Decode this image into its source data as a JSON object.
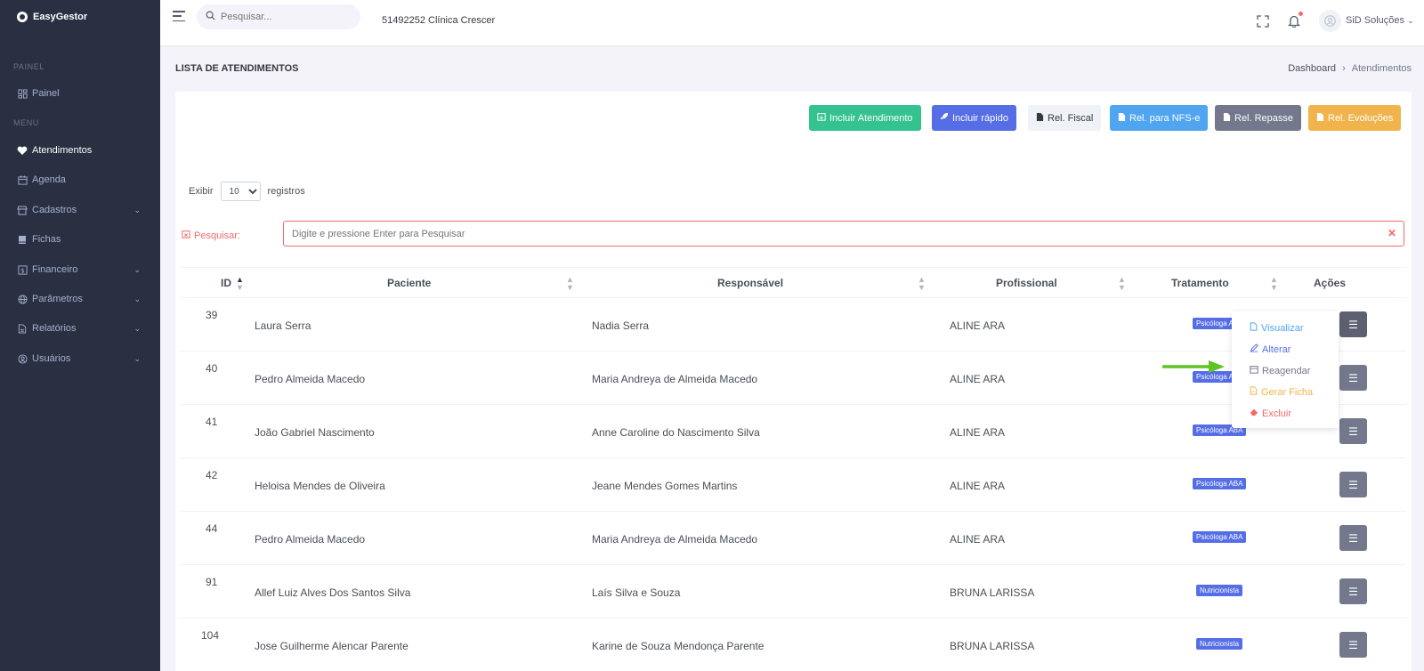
{
  "brand": {
    "name": "EasyGestor"
  },
  "sidebar": {
    "section_painel": "PAINEL",
    "section_menu": "MENU",
    "items": [
      {
        "label": "Painel",
        "icon": "dashboard-icon"
      },
      {
        "label": "Atendimentos",
        "icon": "heart-icon"
      },
      {
        "label": "Agenda",
        "icon": "calendar-icon"
      },
      {
        "label": "Cadastros",
        "icon": "store-icon"
      },
      {
        "label": "Fichas",
        "icon": "book-icon"
      },
      {
        "label": "Financeiro",
        "icon": "dollar-icon"
      },
      {
        "label": "Parâmetros",
        "icon": "globe-icon"
      },
      {
        "label": "Relatórios",
        "icon": "report-icon"
      },
      {
        "label": "Usuários",
        "icon": "user-circle-icon"
      }
    ]
  },
  "topbar": {
    "search_placeholder": "Pesquisar...",
    "company": "51492252 Clínica Crescer",
    "user_name": "SiD Soluções"
  },
  "page": {
    "title": "LISTA DE ATENDIMENTOS",
    "breadcrumb": [
      "Dashboard",
      "Atendimentos"
    ]
  },
  "toolbar": {
    "buttons": [
      {
        "label": "Incluir Atendimento",
        "color": "#34c38f"
      },
      {
        "label": "Incluir rápido",
        "color": "#556ee6"
      },
      {
        "label": "Rel. Fiscal",
        "color": "#eff2f7"
      },
      {
        "label": "Rel. para NFS-e",
        "color": "#50a5f1"
      },
      {
        "label": "Rel. Repasse",
        "color": "#74788d"
      },
      {
        "label": "Rel. Evoluções",
        "color": "#f1b44c"
      }
    ]
  },
  "list_controls": {
    "show_label": "Exibir",
    "page_size": "10",
    "records_label": "registros",
    "search_label": "Pesquisar:",
    "search_placeholder": "Digite e pressione Enter para Pesquisar"
  },
  "table": {
    "columns": [
      "ID",
      "Paciente",
      "Responsável",
      "Profissional",
      "Tratamento",
      "Ações"
    ],
    "rows": [
      {
        "id": "39",
        "paciente": "Laura Serra",
        "responsavel": "Nadia Serra",
        "profissional": "ALINE ARA",
        "tratamento": "Psicóloga ABA"
      },
      {
        "id": "40",
        "paciente": "Pedro Almeida Macedo",
        "responsavel": "Maria Andreya de Almeida Macedo",
        "profissional": "ALINE ARA",
        "tratamento": "Psicóloga ABA"
      },
      {
        "id": "41",
        "paciente": "João Gabriel Nascimento",
        "responsavel": "Anne Caroline do Nascimento Silva",
        "profissional": "ALINE ARA",
        "tratamento": "Psicóloga ABA"
      },
      {
        "id": "42",
        "paciente": "Heloisa Mendes de Oliveira",
        "responsavel": "Jeane Mendes Gomes Martins",
        "profissional": "ALINE ARA",
        "tratamento": "Psicóloga ABA"
      },
      {
        "id": "44",
        "paciente": "Pedro Almeida Macedo",
        "responsavel": "Maria Andreya de Almeida Macedo",
        "profissional": "ALINE ARA",
        "tratamento": "Psicóloga ABA"
      },
      {
        "id": "91",
        "paciente": "Allef Luiz Alves Dos Santos Silva",
        "responsavel": "Laís Silva e Souza",
        "profissional": "BRUNA LARISSA",
        "tratamento": "Nutricionista"
      },
      {
        "id": "104",
        "paciente": "Jose Guilherme Alencar Parente",
        "responsavel": "Karine de Souza Mendonça Parente",
        "profissional": "BRUNA LARISSA",
        "tratamento": "Nutricionista"
      }
    ]
  },
  "actions_menu": {
    "items": [
      {
        "label": "Visualizar",
        "color": "#50a5f1"
      },
      {
        "label": "Alterar",
        "color": "#556ee6"
      },
      {
        "label": "Reagendar",
        "color": "#74788d"
      },
      {
        "label": "Gerar Ficha",
        "color": "#f1b44c"
      },
      {
        "label": "Excluir",
        "color": "#f46a6a"
      }
    ]
  },
  "colors": {
    "sidebar": "#2a3042",
    "accent": "#556ee6",
    "danger": "#f46a6a",
    "arrow": "#5ec422"
  }
}
